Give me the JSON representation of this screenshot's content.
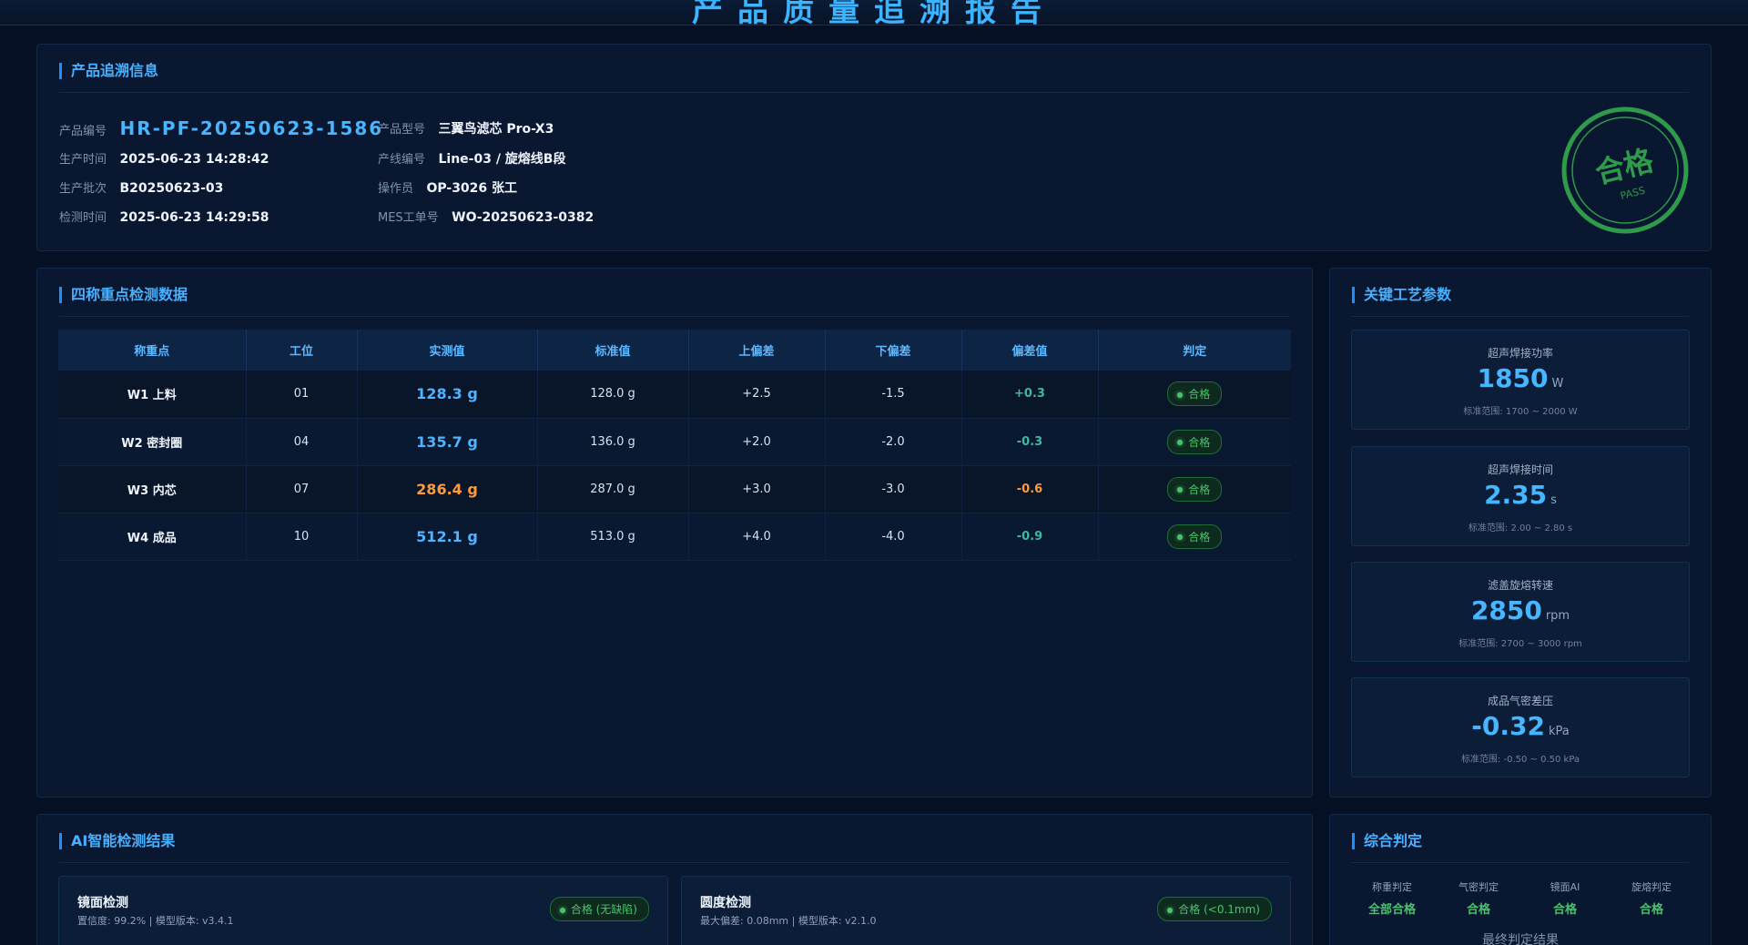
{
  "page": {
    "title": "产品质量追溯报告"
  },
  "product_panel": {
    "title": "产品追溯信息",
    "fields": [
      {
        "label": "产品编号",
        "value": "HR-PF-20250623-1586"
      },
      {
        "label": "生产时间",
        "value": "2025-06-23 14:28:42"
      },
      {
        "label": "生产批次",
        "value": "B20250623-03"
      },
      {
        "label": "检测时间",
        "value": "2025-06-23 14:29:58"
      },
      {
        "label": "产品型号",
        "value": "三翼鸟滤芯 Pro-X3"
      },
      {
        "label": "产线编号",
        "value": "Line-03 / 旋熔线B段"
      },
      {
        "label": "操作员",
        "value": "OP-3026 张工"
      },
      {
        "label": "MES工单号",
        "value": "WO-20250623-0382"
      }
    ],
    "stamp": {
      "main": "合格",
      "sub": "PASS",
      "color": "#2f9a4a"
    }
  },
  "weigh_panel": {
    "title": "四称重点检测数据",
    "columns": [
      "称重点",
      "工位",
      "实测值",
      "标准值",
      "上偏差",
      "下偏差",
      "偏差值",
      "判定"
    ],
    "rows": [
      {
        "point": "W1 上料",
        "station": "01",
        "measured": "128.3 g",
        "standard": "128.0 g",
        "upper": "+2.5",
        "lower": "-1.5",
        "deviation": "+0.3",
        "result": "合格",
        "warn": false
      },
      {
        "point": "W2 密封圈",
        "station": "04",
        "measured": "135.7 g",
        "standard": "136.0 g",
        "upper": "+2.0",
        "lower": "-2.0",
        "deviation": "-0.3",
        "result": "合格",
        "warn": false
      },
      {
        "point": "W3 内芯",
        "station": "07",
        "measured": "286.4 g",
        "standard": "287.0 g",
        "upper": "+3.0",
        "lower": "-3.0",
        "deviation": "-0.6",
        "result": "合格",
        "warn": true
      },
      {
        "point": "W4 成品",
        "station": "10",
        "measured": "512.1 g",
        "standard": "513.0 g",
        "upper": "+4.0",
        "lower": "-4.0",
        "deviation": "-0.9",
        "result": "合格",
        "warn": false
      }
    ]
  },
  "params_panel": {
    "title": "关键工艺参数",
    "items": [
      {
        "name": "超声焊接功率",
        "value": "1850",
        "unit": "W",
        "range": "标准范围: 1700 ~ 2000 W"
      },
      {
        "name": "超声焊接时间",
        "value": "2.35",
        "unit": "s",
        "range": "标准范围: 2.00 ~ 2.80 s"
      },
      {
        "name": "滤盖旋熔转速",
        "value": "2850",
        "unit": "rpm",
        "range": "标准范围: 2700 ~ 3000 rpm"
      },
      {
        "name": "成品气密差压",
        "value": "-0.32",
        "unit": "kPa",
        "range": "标准范围: -0.50 ~ 0.50 kPa"
      }
    ]
  },
  "ai_panel": {
    "title": "AI智能检测结果",
    "cards": [
      {
        "name": "镜面检测",
        "info": "置信度: 99.2% | 模型版本: v3.4.1",
        "result": "合格 (无缺陷)"
      },
      {
        "name": "圆度检测",
        "info": "最大偏差: 0.08mm | 模型版本: v2.1.0",
        "result": "合格 (<0.1mm)"
      }
    ]
  },
  "verdict_panel": {
    "title": "综合判定",
    "items": [
      {
        "label": "称重判定",
        "value": "全部合格"
      },
      {
        "label": "气密判定",
        "value": "合格"
      },
      {
        "label": "镜面AI",
        "value": "合格"
      },
      {
        "label": "旋熔判定",
        "value": "合格"
      }
    ],
    "final_label": "最终判定结果"
  }
}
